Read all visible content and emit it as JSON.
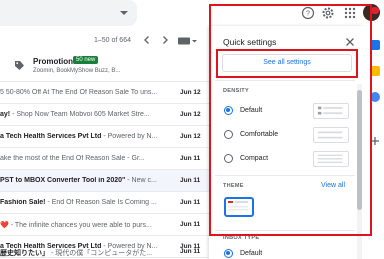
{
  "header": {
    "icons": [
      "chevron-down-icon",
      "help-icon",
      "gear-icon",
      "apps-icon",
      "avatar"
    ]
  },
  "toolbar": {
    "pager_text": "1–50 of 664",
    "prev_icon": "chevron-left-icon",
    "next_icon": "chevron-right-icon"
  },
  "inbox": {
    "promotions": {
      "title": "Promotions",
      "badge": "50 new",
      "subtitle": "Zoomin, BookMyShow Buzz, B..."
    },
    "rows": [
      {
        "subject": "",
        "snippet": "5 50-80% Off At The End Of Reason Sale To uns...",
        "date": "Jun 12",
        "read": false
      },
      {
        "subject": "ay!",
        "snippet": " - Shop Now Team Mobvoi 605 Market Stre...",
        "date": "Jun 12",
        "read": false
      },
      {
        "subject": "a Tech Health Services Pvt Ltd",
        "snippet": " - Powered by N...",
        "date": "Jun 12",
        "read": false
      },
      {
        "subject": "",
        "snippet": "ake the most of the End Of Reason Sale - Gr...",
        "date": "Jun 11",
        "read": false
      },
      {
        "subject": "PST to MBOX Converter Tool in 2020\"",
        "snippet": " - New c...",
        "date": "Jun 11",
        "read": true
      },
      {
        "subject": "Fashion Sale!",
        "snippet": " - End Of Reason Sale Is Coming ...",
        "date": "Jun 11",
        "read": false
      },
      {
        "subject": "❤️",
        "snippet": " - The infinite chances you were able to purs...",
        "date": "Jun 11",
        "read": false
      },
      {
        "subject": "a Tech Health Services Pvt Ltd",
        "snippet": " - Powered by N...",
        "date": "Jun 11",
        "read": false
      },
      {
        "subject": "歴史知りたい」",
        "snippet": " - 現代の僕「コンピュータがた...",
        "date": "Jun 11",
        "read": false
      }
    ]
  },
  "quick_settings": {
    "title": "Quick settings",
    "see_all": "See all settings",
    "density_label": "DENSITY",
    "density_options": [
      {
        "label": "Default",
        "checked": true
      },
      {
        "label": "Comfortable",
        "checked": false
      },
      {
        "label": "Compact",
        "checked": false
      }
    ],
    "theme_label": "THEME",
    "view_all": "View all",
    "inbox_type_label": "INBOX TYPE",
    "inbox_type_first": "Default"
  },
  "colors": {
    "accent": "#1a73e8",
    "annotation": "#e0141e",
    "badge": "#188038"
  }
}
